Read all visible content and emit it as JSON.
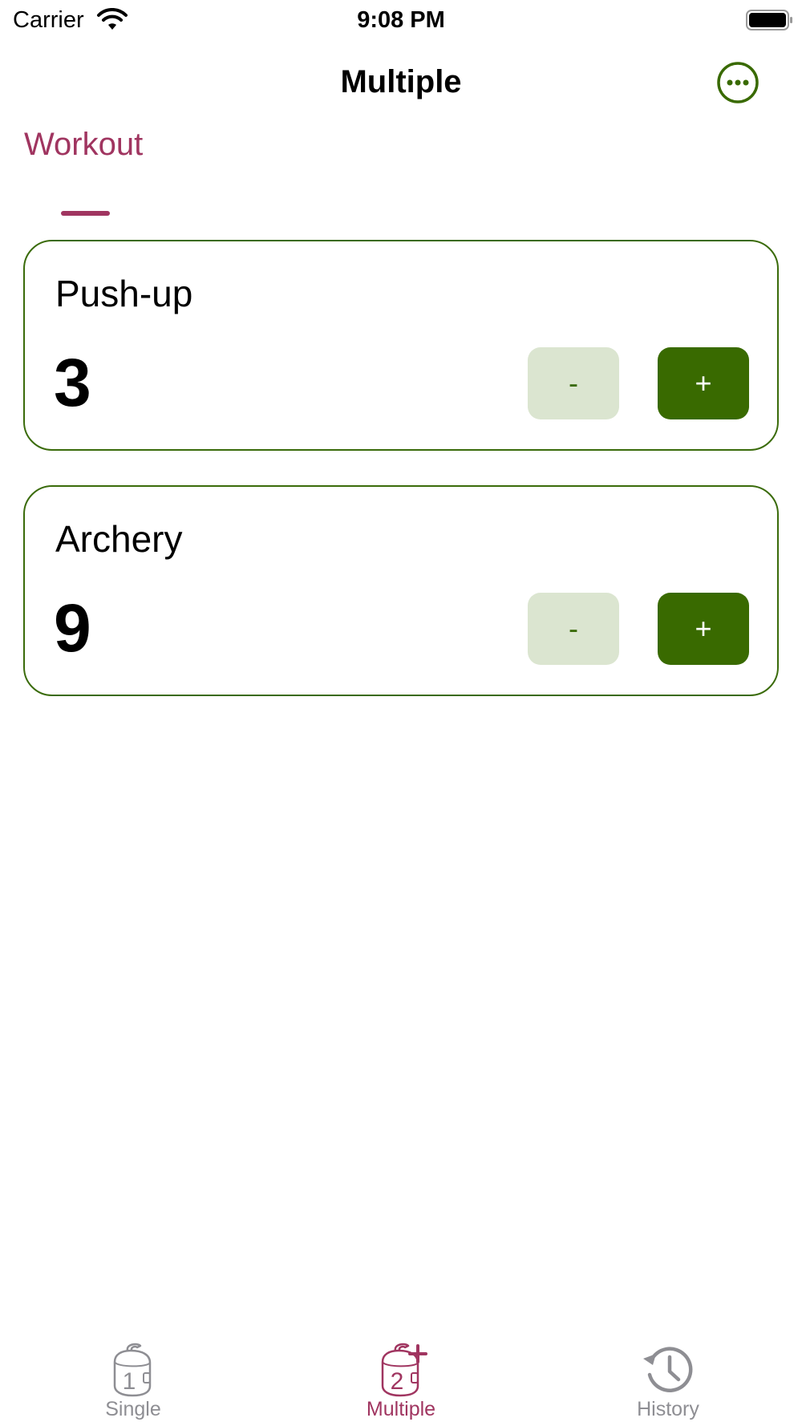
{
  "status_bar": {
    "carrier": "Carrier",
    "time": "9:08 PM"
  },
  "nav": {
    "title": "Multiple",
    "more_icon": "ellipsis-circle-icon"
  },
  "segment": {
    "label": "Workout"
  },
  "counters": [
    {
      "name": "Push-up",
      "value": "3",
      "decrement_label": "-",
      "increment_label": "+"
    },
    {
      "name": "Archery",
      "value": "9",
      "decrement_label": "-",
      "increment_label": "+"
    }
  ],
  "tab_bar": {
    "items": [
      {
        "label": "Single",
        "icon": "single-counter-icon",
        "active": false
      },
      {
        "label": "Multiple",
        "icon": "multiple-counter-icon",
        "active": true
      },
      {
        "label": "History",
        "icon": "history-icon",
        "active": false
      }
    ]
  },
  "colors": {
    "accent_green": "#396a00",
    "light_green": "#dbe5d0",
    "accent_magenta": "#a03560",
    "inactive_gray": "#8e8e93"
  }
}
